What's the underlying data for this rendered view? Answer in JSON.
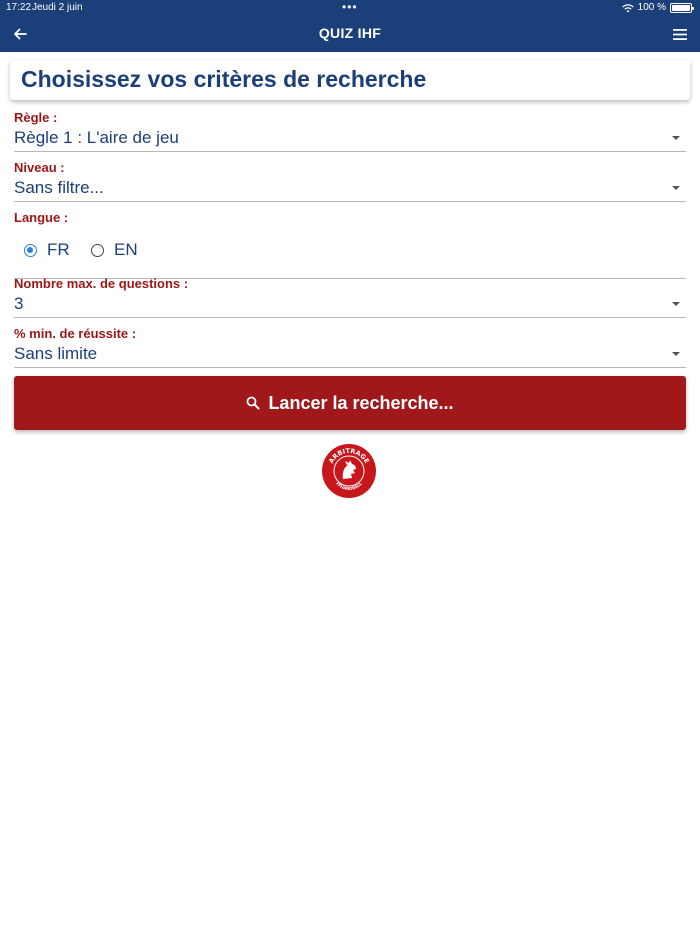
{
  "status_bar": {
    "time": "17:22",
    "date": "Jeudi 2 juin",
    "multitask_dots": "•••",
    "battery_percent": "100 %"
  },
  "nav": {
    "title": "QUIZ IHF",
    "back_icon": "arrow-left-icon",
    "menu_icon": "hamburger-menu-icon"
  },
  "card": {
    "title": "Choisissez vos critères de recherche"
  },
  "form": {
    "regle": {
      "label": "Règle :",
      "value": "Règle 1 : L'aire de jeu"
    },
    "niveau": {
      "label": "Niveau :",
      "value": "Sans filtre..."
    },
    "langue": {
      "label": "Langue :",
      "options": [
        {
          "label": "FR",
          "selected": true
        },
        {
          "label": "EN",
          "selected": false
        }
      ]
    },
    "max_questions": {
      "label": "Nombre max. de questions :",
      "value": "3"
    },
    "min_reussite": {
      "label": "% min. de réussite :",
      "value": "Sans limite"
    }
  },
  "search_button": {
    "label": "Lancer la recherche...",
    "icon": "search-icon"
  },
  "logo": {
    "top_text": "ARBITRAGE",
    "bottom_text": "FFHANDBALL"
  },
  "colors": {
    "primary_blue": "#1b3f78",
    "accent_red": "#a1181b",
    "label_red": "#9b1717",
    "radio_blue": "#2a7fd4"
  }
}
